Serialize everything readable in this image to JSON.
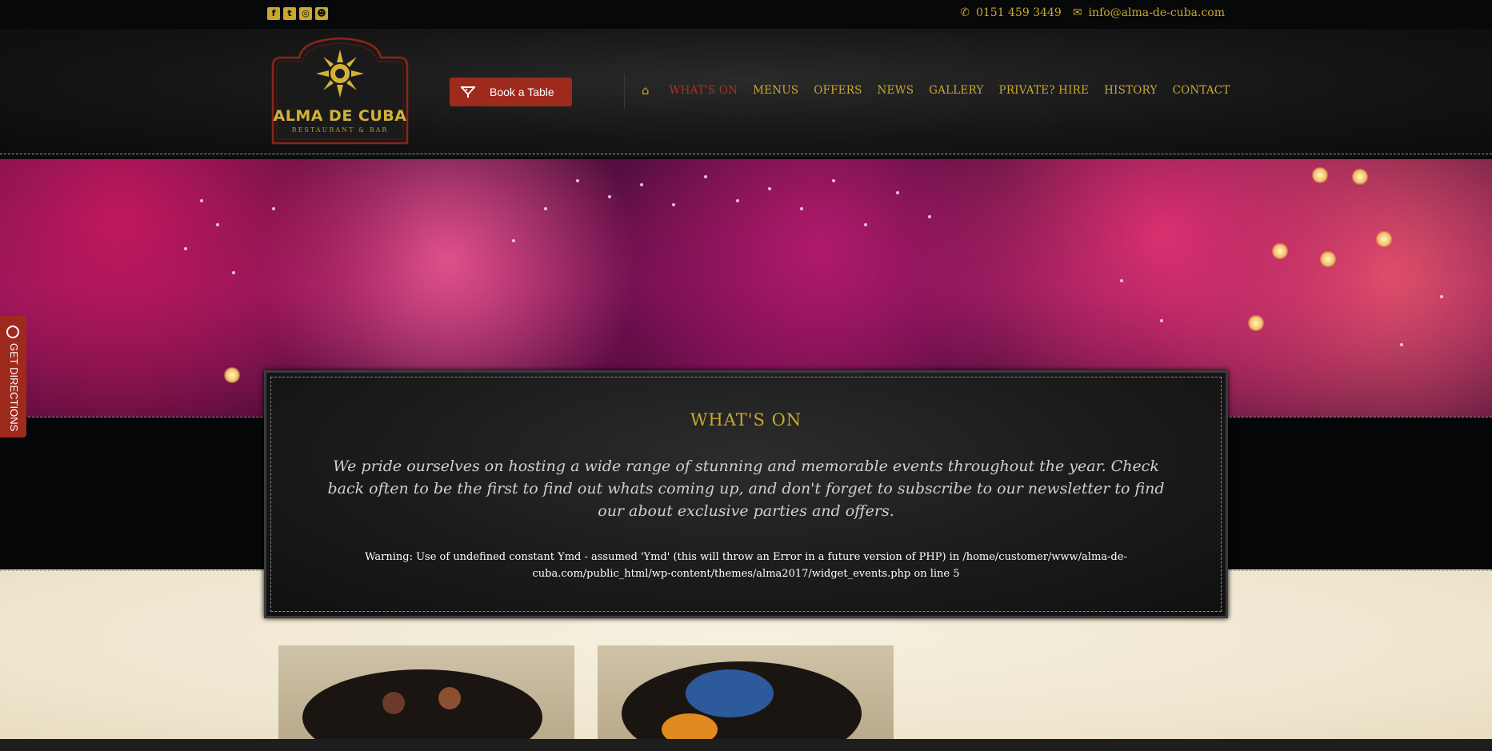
{
  "topbar": {
    "social_icons": [
      "facebook-icon",
      "twitter-icon",
      "instagram-icon",
      "snapchat-icon"
    ],
    "phone": "0151 459 3449",
    "email": "info@alma-de-cuba.com"
  },
  "header": {
    "logo": {
      "brand": "ALMA DE CUBA",
      "tagline": "RESTAURANT & BAR"
    },
    "book_button": "Book a Table",
    "nav": [
      {
        "label": "WHAT'S ON",
        "active": true
      },
      {
        "label": "MENUS",
        "active": false
      },
      {
        "label": "OFFERS",
        "active": false
      },
      {
        "label": "NEWS",
        "active": false
      },
      {
        "label": "GALLERY",
        "active": false
      },
      {
        "label": "PRIVATE? HIRE",
        "active": false
      },
      {
        "label": "HISTORY",
        "active": false
      },
      {
        "label": "CONTACT",
        "active": false
      }
    ]
  },
  "main": {
    "title": "WHAT'S ON",
    "lead": "We pride ourselves on hosting a wide range of stunning and memorable events throughout the year. Check back often to be the first to find out whats coming up, and don't forget to subscribe to our newsletter to find our about exclusive parties and offers.",
    "warning": "Warning: Use of undefined constant Ymd - assumed 'Ymd' (this will throw an Error in a future version of PHP) in /home/customer/www/alma-de-cuba.com/public_html/wp-content/themes/alma2017/widget_events.php on line 5"
  },
  "directions": {
    "label": "GET DIRECTIONS"
  },
  "colors": {
    "gold": "#c9a830",
    "accent_red": "#9e2a1e",
    "active_nav": "#a8341f",
    "background": "#0b0c0d",
    "parchment": "#efe6cf"
  }
}
